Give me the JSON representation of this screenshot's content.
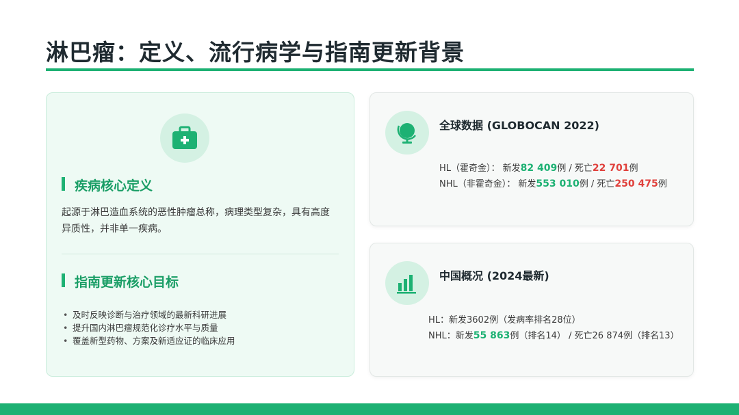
{
  "title": "淋巴瘤：定义、流行病学与指南更新背景",
  "colors": {
    "accent": "#1db173",
    "death": "#e0403b"
  },
  "left_card": {
    "icon": "medical-kit-icon",
    "definition_heading": "疾病核心定义",
    "definition_text": "起源于淋巴造血系统的恶性肿瘤总称，病理类型复杂，具有高度异质性，并非单一疾病。",
    "goals_heading": "指南更新核心目标",
    "goals": [
      "及时反映诊断与治疗领域的最新科研进展",
      "提升国内淋巴瘤规范化诊疗水平与质量",
      "覆盖新型药物、方案及新适应证的临床应用"
    ]
  },
  "global_card": {
    "icon": "globe-icon",
    "title": "全球数据 (GLOBOCAN 2022)",
    "hl": {
      "label": "HL（霍奇金）：  新发",
      "new": "82 409",
      "mid": "例 / 死亡",
      "death": "22 701",
      "end": "例"
    },
    "nhl": {
      "label": "NHL（非霍奇金）：  新发",
      "new": "553 010",
      "mid": "例 / 死亡",
      "death": "250 475",
      "end": "例"
    }
  },
  "china_card": {
    "icon": "bar-chart-icon",
    "title": "中国概况 (2024最新)",
    "hl_text": "HL：新发3602例（发病率排名28位）",
    "nhl": {
      "label": "NHL：新发",
      "new": "55 863",
      "rest": "例（排名14） / 死亡26 874例（排名13）"
    }
  }
}
